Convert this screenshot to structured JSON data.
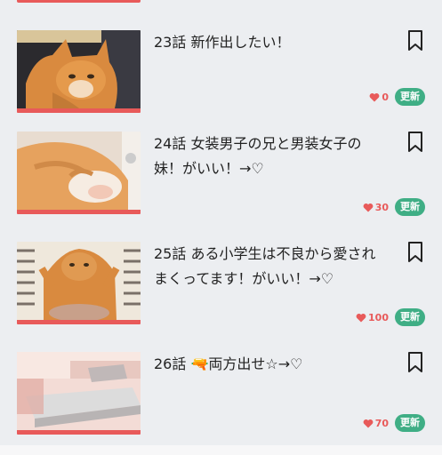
{
  "episodes": [
    {
      "title": "23話 新作出したい！",
      "likes": "0",
      "badge": "更新"
    },
    {
      "title": "24話 女装男子の兄と男装女子の妹！がいい！→♡",
      "likes": "30",
      "badge": "更新"
    },
    {
      "title": "25話 ある小学生は不良から愛されまくってます！がいい！→♡",
      "likes": "100",
      "badge": "更新"
    },
    {
      "title": "26話 🔫両方出せ☆→♡",
      "likes": "70",
      "badge": "更新"
    }
  ],
  "colors": {
    "accent": "#e85a5a",
    "badge": "#3fae85"
  },
  "icons": {
    "bookmark": "bookmark-icon",
    "like": "heart-icon"
  }
}
